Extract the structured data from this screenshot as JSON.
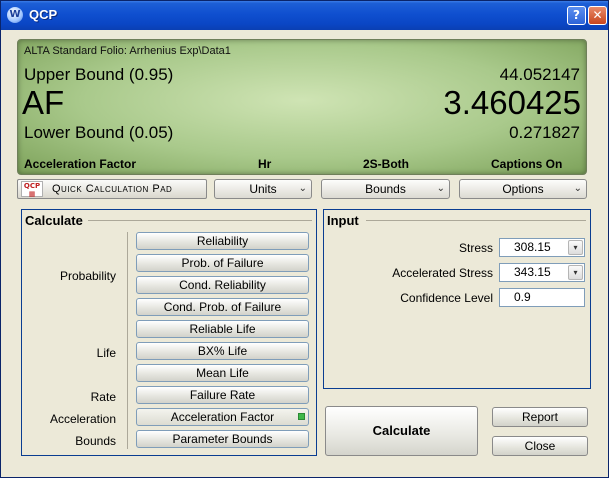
{
  "window": {
    "title": "QCP",
    "app_icon": "W",
    "help_glyph": "?",
    "close_glyph": "✕"
  },
  "display": {
    "folio": "ALTA Standard Folio: Arrhenius Exp\\Data1",
    "upper_label": "Upper Bound (0.95)",
    "upper_value": "44.052147",
    "main_label": "AF",
    "main_value": "3.460425",
    "lower_label": "Lower Bound (0.05)",
    "lower_value": "0.271827",
    "status": [
      "Acceleration Factor",
      "Hr",
      "2S-Both",
      "Captions On"
    ]
  },
  "toolbar": {
    "qcp_logo_top": "QCP",
    "qcp_logo_bottom": "▦",
    "qcp_label": "Quick Calculation Pad",
    "units_label": "Units",
    "bounds_label": "Bounds",
    "options_label": "Options",
    "chevron": "⌄"
  },
  "calculate": {
    "title": "Calculate",
    "categories": {
      "probability": "Probability",
      "life": "Life",
      "rate": "Rate",
      "acceleration": "Acceleration",
      "bounds": "Bounds"
    },
    "buttons": [
      "Reliability",
      "Prob. of Failure",
      "Cond. Reliability",
      "Cond. Prob. of Failure",
      "Reliable Life",
      "BX% Life",
      "Mean Life",
      "Failure Rate",
      "Acceleration Factor",
      "Parameter Bounds"
    ],
    "selected": "Acceleration Factor",
    "indicator_color": "#3fb84a"
  },
  "input": {
    "title": "Input",
    "stress_label": "Stress",
    "stress_value": "308.15",
    "accel_stress_label": "Accelerated Stress",
    "accel_stress_value": "343.15",
    "confidence_label": "Confidence Level",
    "confidence_value": "0.9",
    "spin_glyph": "▾"
  },
  "actions": {
    "calculate": "Calculate",
    "report": "Report",
    "close": "Close"
  },
  "colors": {
    "title_bar": "#0a46c4",
    "display_bg": "#a9c98b",
    "group_border": "#0a3d91"
  }
}
